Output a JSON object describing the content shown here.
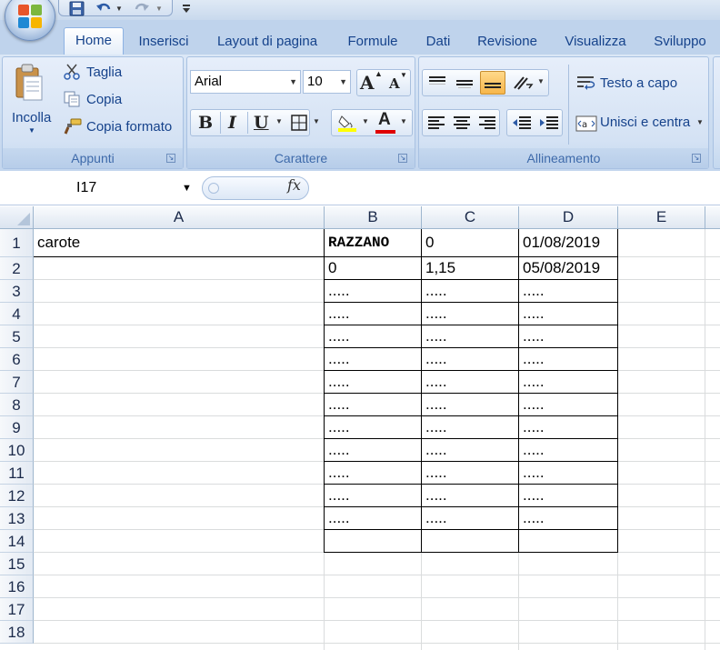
{
  "app": {
    "quick_access": [
      "save-icon",
      "undo-icon",
      "redo-icon",
      "customize-icon"
    ]
  },
  "tabs": [
    "Home",
    "Inserisci",
    "Layout di pagina",
    "Formule",
    "Dati",
    "Revisione",
    "Visualizza",
    "Sviluppo"
  ],
  "ribbon": {
    "appunti": {
      "label": "Appunti",
      "paste": "Incolla",
      "cut": "Taglia",
      "copy": "Copia",
      "format_painter": "Copia formato"
    },
    "carattere": {
      "label": "Carattere",
      "font": "Arial",
      "size": "10",
      "bold": "B",
      "italic": "I",
      "underline": "U",
      "font_color_letter": "A",
      "grow": "A",
      "shrink": "A",
      "fill_color": "#ffff00",
      "font_color": "#e00000"
    },
    "allineamento": {
      "label": "Allineamento",
      "wrap_text": "Testo a capo",
      "merge_center": "Unisci e centra"
    }
  },
  "formula_bar": {
    "name_box": "I17",
    "fx": "fx",
    "content": ""
  },
  "sheet": {
    "columns": [
      "A",
      "B",
      "C",
      "D",
      "E"
    ],
    "rows": [
      "1",
      "2",
      "3",
      "4",
      "5",
      "6",
      "7",
      "8",
      "9",
      "10",
      "11",
      "12",
      "13",
      "14",
      "15",
      "16",
      "17",
      "18"
    ],
    "cells": {
      "A1": "carote",
      "B1": "RAZZANO",
      "C1": "0",
      "D1": "01/08/2019",
      "B2": "0",
      "C2": "1,15",
      "D2": "05/08/2019",
      "B3": ".....",
      "C3": ".....",
      "D3": ".....",
      "B4": ".....",
      "C4": ".....",
      "D4": ".....",
      "B5": ".....",
      "C5": ".....",
      "D5": ".....",
      "B6": ".....",
      "C6": ".....",
      "D6": ".....",
      "B7": ".....",
      "C7": ".....",
      "D7": ".....",
      "B8": ".....",
      "C8": ".....",
      "D8": ".....",
      "B9": ".....",
      "C9": ".....",
      "D9": ".....",
      "B10": ".....",
      "C10": ".....",
      "D10": ".....",
      "B11": ".....",
      "C11": ".....",
      "D11": ".....",
      "B12": ".....",
      "C12": ".....",
      "D12": ".....",
      "B13": ".....",
      "C13": ".....",
      "D13": "....."
    }
  }
}
